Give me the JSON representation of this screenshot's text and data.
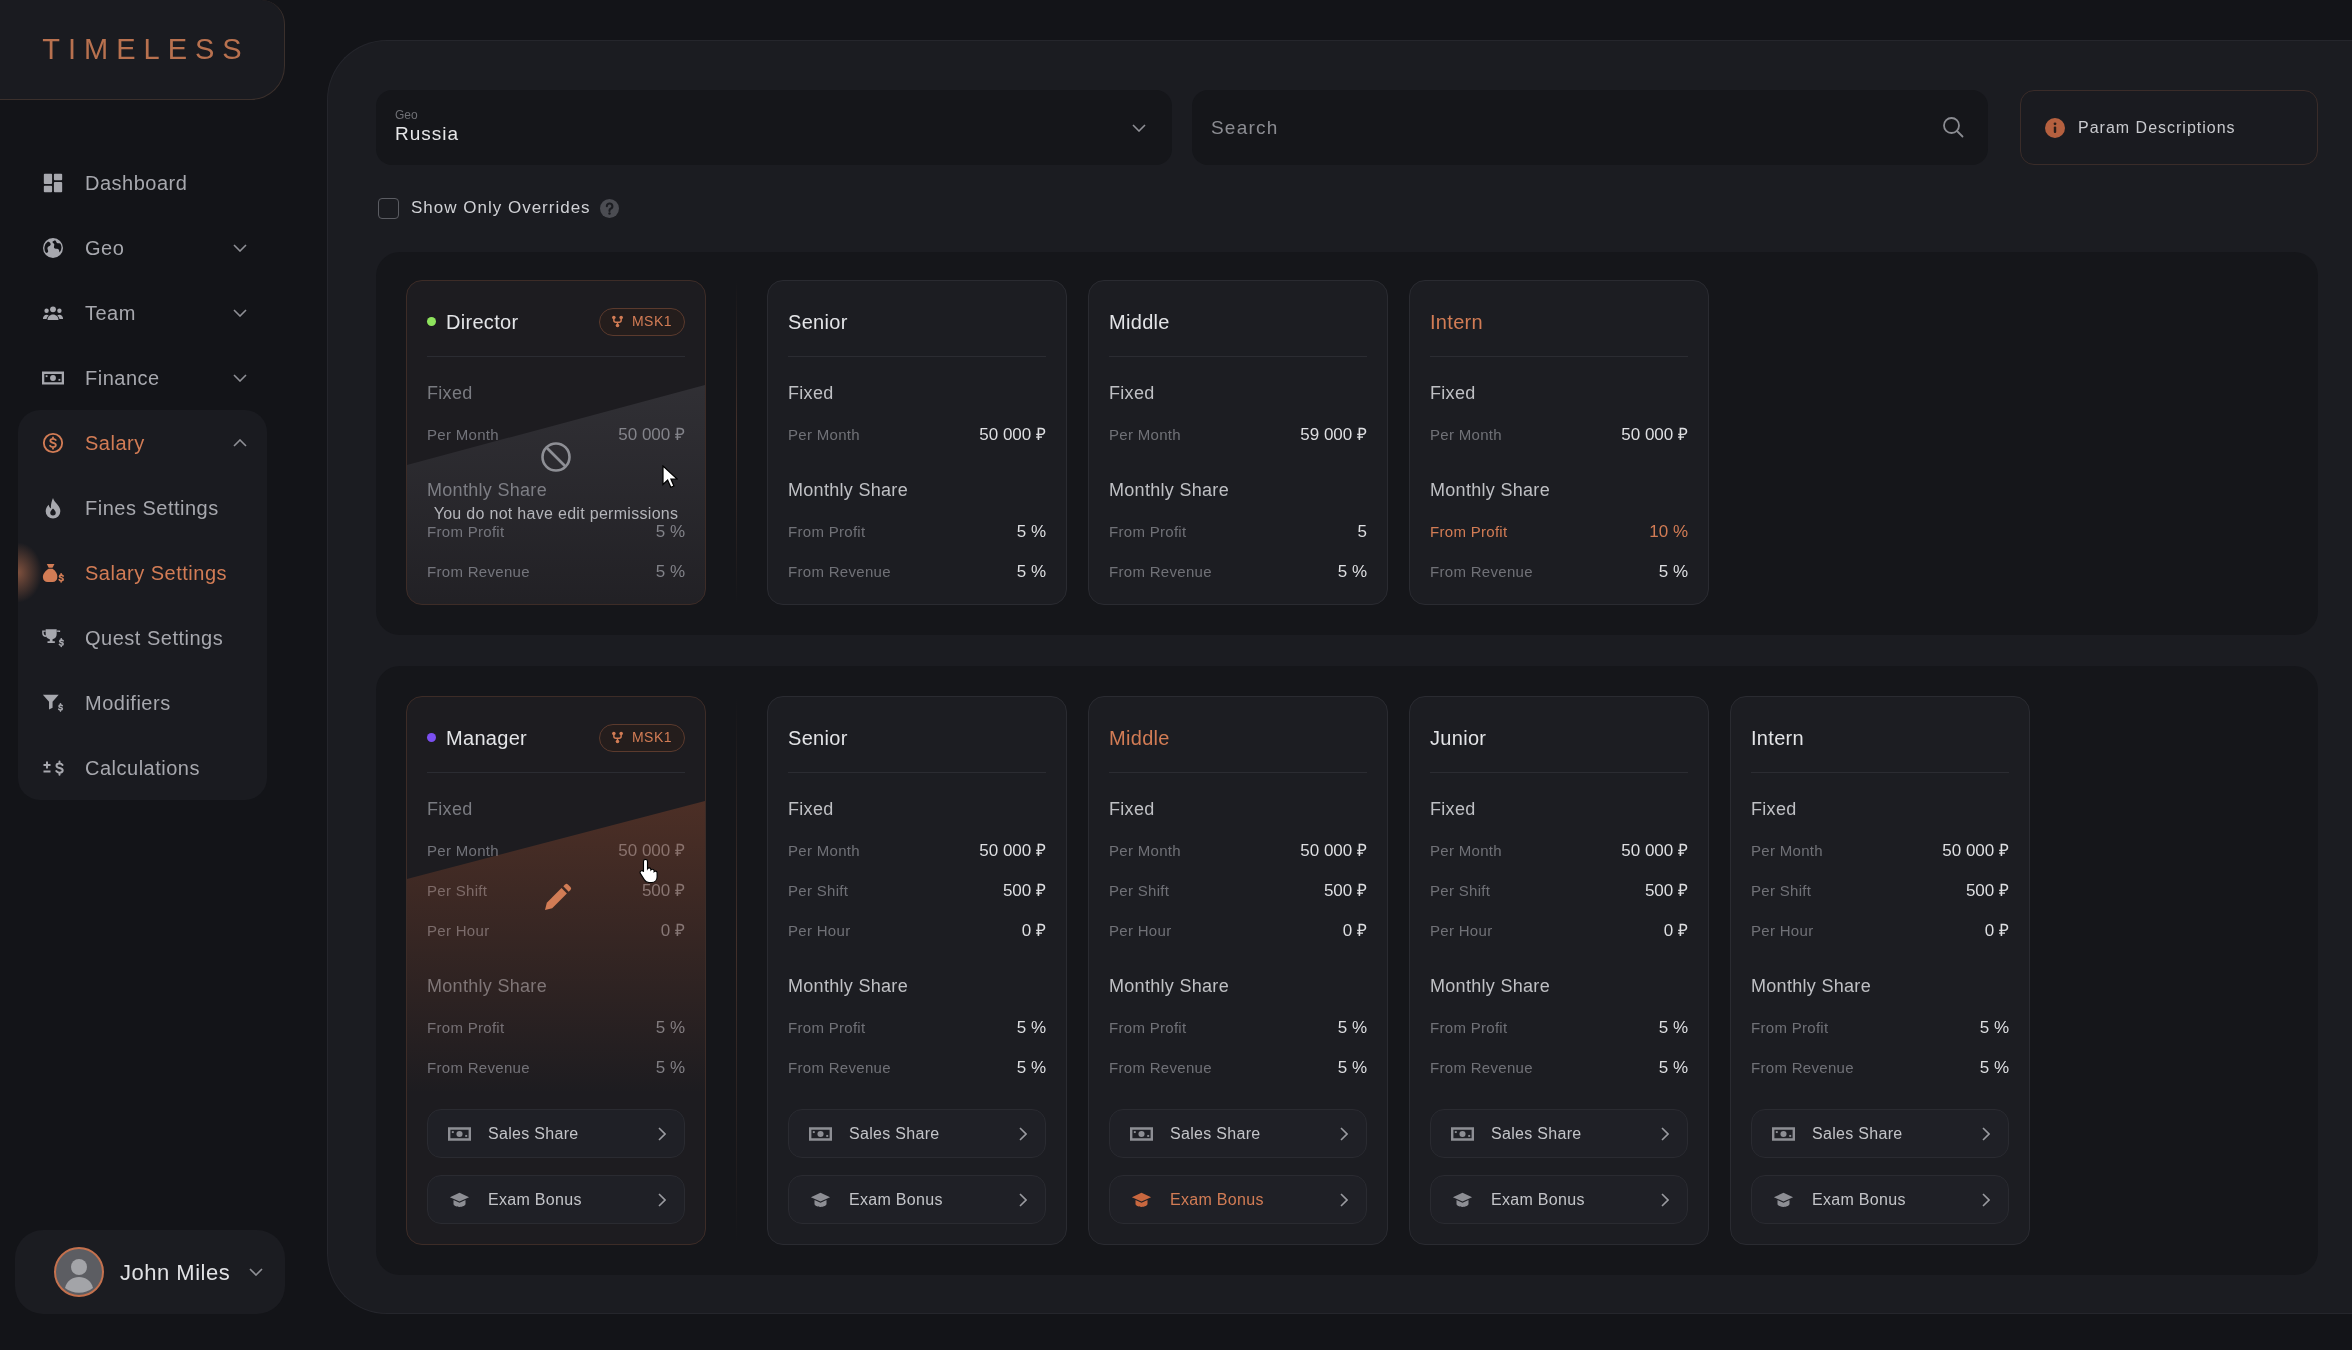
{
  "logo": {
    "text": "TIMELESS"
  },
  "sidebar": {
    "items": [
      {
        "label": "Dashboard",
        "kind": "link",
        "selected": false
      },
      {
        "label": "Geo",
        "kind": "group",
        "selected": false,
        "expanded": false
      },
      {
        "label": "Team",
        "kind": "group",
        "selected": false,
        "expanded": false
      },
      {
        "label": "Finance",
        "kind": "group",
        "selected": false,
        "expanded": false
      },
      {
        "label": "Salary",
        "kind": "group",
        "selected": true,
        "expanded": true,
        "children": [
          {
            "label": "Fines Settings",
            "selected": false
          },
          {
            "label": "Salary Settings",
            "selected": true
          },
          {
            "label": "Quest Settings",
            "selected": false
          },
          {
            "label": "Modifiers",
            "selected": false
          },
          {
            "label": "Calculations",
            "selected": false
          }
        ]
      }
    ]
  },
  "user": {
    "name": "John Miles"
  },
  "filters": {
    "geo": {
      "label": "Geo",
      "value": "Russia"
    },
    "search": {
      "placeholder": "Search"
    },
    "param_button": {
      "label": "Param Descriptions"
    },
    "overrides_only": {
      "label": "Show Only Overrides",
      "checked": false
    }
  },
  "groups": [
    {
      "lead": {
        "title": "Director",
        "color": "#8ee35d",
        "badge": "MSK1",
        "overlay": {
          "kind": "locked",
          "message": "You do not have edit permissions"
        },
        "sections": [
          {
            "title": "Fixed",
            "rows": [
              {
                "label": "Per Month",
                "value": "50 000 ₽"
              }
            ]
          },
          {
            "title": "Monthly Share",
            "rows": [
              {
                "label": "From Profit",
                "value": "5 %"
              },
              {
                "label": "From Revenue",
                "value": "5 %"
              }
            ]
          }
        ]
      },
      "cards": [
        {
          "title": "Senior",
          "overridden": false,
          "sections": [
            {
              "title": "Fixed",
              "rows": [
                {
                  "label": "Per Month",
                  "value": "50 000 ₽",
                  "overridden": false
                }
              ]
            },
            {
              "title": "Monthly Share",
              "rows": [
                {
                  "label": "From Profit",
                  "value": "5 %",
                  "overridden": false
                },
                {
                  "label": "From Revenue",
                  "value": "5 %",
                  "overridden": false
                }
              ]
            }
          ]
        },
        {
          "title": "Middle",
          "overridden": false,
          "sections": [
            {
              "title": "Fixed",
              "rows": [
                {
                  "label": "Per Month",
                  "value": "59 000 ₽",
                  "overridden": false
                }
              ]
            },
            {
              "title": "Monthly Share",
              "rows": [
                {
                  "label": "From Profit",
                  "value": "5",
                  "overridden": false
                },
                {
                  "label": "From Revenue",
                  "value": "5 %",
                  "overridden": false
                }
              ]
            }
          ]
        },
        {
          "title": "Intern",
          "overridden": true,
          "sections": [
            {
              "title": "Fixed",
              "rows": [
                {
                  "label": "Per Month",
                  "value": "50 000 ₽",
                  "overridden": false
                }
              ]
            },
            {
              "title": "Monthly Share",
              "rows": [
                {
                  "label": "From Profit",
                  "value": "10 %",
                  "overridden": true
                },
                {
                  "label": "From Revenue",
                  "value": "5 %",
                  "overridden": false
                }
              ]
            }
          ]
        }
      ]
    },
    {
      "lead": {
        "title": "Manager",
        "color": "#7b4ff0",
        "badge": "MSK1",
        "overlay": {
          "kind": "edit"
        },
        "sections": [
          {
            "title": "Fixed",
            "rows": [
              {
                "label": "Per Month",
                "value": "50 000 ₽"
              },
              {
                "label": "Per Shift",
                "value": "500 ₽"
              },
              {
                "label": "Per Hour",
                "value": "0 ₽"
              }
            ]
          },
          {
            "title": "Monthly Share",
            "rows": [
              {
                "label": "From Profit",
                "value": "5 %"
              },
              {
                "label": "From Revenue",
                "value": "5 %"
              }
            ]
          }
        ],
        "buttons": [
          {
            "label": "Sales Share",
            "overridden": false
          },
          {
            "label": "Exam Bonus",
            "overridden": false
          }
        ]
      },
      "cards": [
        {
          "title": "Senior",
          "overridden": false,
          "sections": [
            {
              "title": "Fixed",
              "rows": [
                {
                  "label": "Per Month",
                  "value": "50 000 ₽",
                  "overridden": false
                },
                {
                  "label": "Per Shift",
                  "value": "500 ₽",
                  "overridden": false
                },
                {
                  "label": "Per Hour",
                  "value": "0 ₽",
                  "overridden": false
                }
              ]
            },
            {
              "title": "Monthly Share",
              "rows": [
                {
                  "label": "From Profit",
                  "value": "5 %",
                  "overridden": false
                },
                {
                  "label": "From Revenue",
                  "value": "5 %",
                  "overridden": false
                }
              ]
            }
          ],
          "buttons": [
            {
              "label": "Sales Share",
              "overridden": false
            },
            {
              "label": "Exam Bonus",
              "overridden": false
            }
          ]
        },
        {
          "title": "Middle",
          "overridden": true,
          "sections": [
            {
              "title": "Fixed",
              "rows": [
                {
                  "label": "Per Month",
                  "value": "50 000 ₽",
                  "overridden": false
                },
                {
                  "label": "Per Shift",
                  "value": "500 ₽",
                  "overridden": false
                },
                {
                  "label": "Per Hour",
                  "value": "0 ₽",
                  "overridden": false
                }
              ]
            },
            {
              "title": "Monthly Share",
              "rows": [
                {
                  "label": "From Profit",
                  "value": "5 %",
                  "overridden": false
                },
                {
                  "label": "From Revenue",
                  "value": "5 %",
                  "overridden": false
                }
              ]
            }
          ],
          "buttons": [
            {
              "label": "Sales Share",
              "overridden": false
            },
            {
              "label": "Exam Bonus",
              "overridden": true
            }
          ]
        },
        {
          "title": "Junior",
          "overridden": false,
          "sections": [
            {
              "title": "Fixed",
              "rows": [
                {
                  "label": "Per Month",
                  "value": "50 000 ₽",
                  "overridden": false
                },
                {
                  "label": "Per Shift",
                  "value": "500 ₽",
                  "overridden": false
                },
                {
                  "label": "Per Hour",
                  "value": "0 ₽",
                  "overridden": false
                }
              ]
            },
            {
              "title": "Monthly Share",
              "rows": [
                {
                  "label": "From Profit",
                  "value": "5 %",
                  "overridden": false
                },
                {
                  "label": "From Revenue",
                  "value": "5 %",
                  "overridden": false
                }
              ]
            }
          ],
          "buttons": [
            {
              "label": "Sales Share",
              "overridden": false
            },
            {
              "label": "Exam Bonus",
              "overridden": false
            }
          ]
        },
        {
          "title": "Intern",
          "overridden": false,
          "sections": [
            {
              "title": "Fixed",
              "rows": [
                {
                  "label": "Per Month",
                  "value": "50 000 ₽",
                  "overridden": false
                },
                {
                  "label": "Per Shift",
                  "value": "500 ₽",
                  "overridden": false
                },
                {
                  "label": "Per Hour",
                  "value": "0 ₽",
                  "overridden": false
                }
              ]
            },
            {
              "title": "Monthly Share",
              "rows": [
                {
                  "label": "From Profit",
                  "value": "5 %",
                  "overridden": false
                },
                {
                  "label": "From Revenue",
                  "value": "5 %",
                  "overridden": false
                }
              ]
            }
          ],
          "buttons": [
            {
              "label": "Sales Share",
              "overridden": false
            },
            {
              "label": "Exam Bonus",
              "overridden": false
            }
          ]
        }
      ]
    }
  ]
}
